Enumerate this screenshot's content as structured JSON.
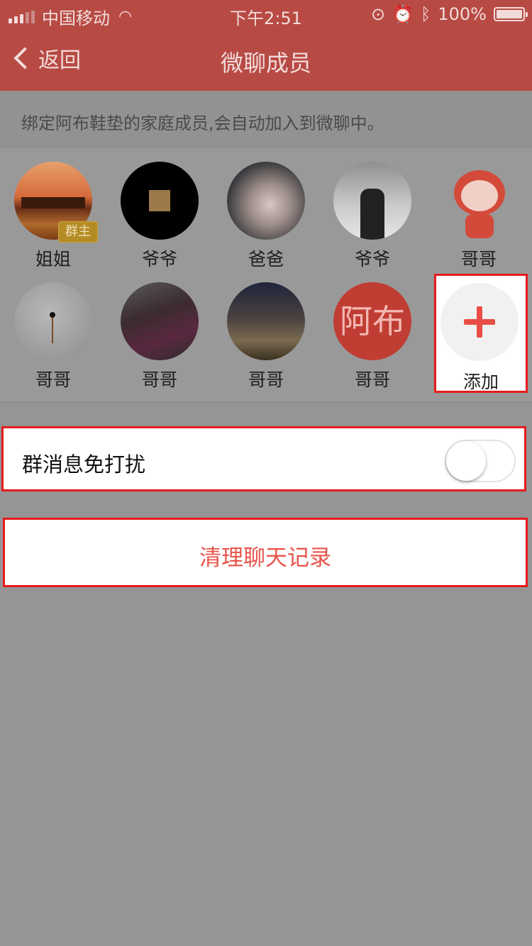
{
  "status_bar": {
    "carrier": "中国移动",
    "time": "下午2:51",
    "battery": "100%"
  },
  "nav": {
    "back_label": "返回",
    "title": "微聊成员"
  },
  "description": "绑定阿布鞋垫的家庭成员,会自动加入到微聊中。",
  "members": [
    {
      "name": "姐姐",
      "badge": "群主"
    },
    {
      "name": "爷爷"
    },
    {
      "name": "爸爸"
    },
    {
      "name": "爷爷"
    },
    {
      "name": "哥哥"
    },
    {
      "name": "哥哥"
    },
    {
      "name": "哥哥"
    },
    {
      "name": "哥哥"
    },
    {
      "name": "哥哥",
      "avatar_text": "阿布"
    }
  ],
  "add": {
    "label": "添加"
  },
  "dnd": {
    "label": "群消息免打扰",
    "enabled": false
  },
  "clear": {
    "label": "清理聊天记录"
  },
  "colors": {
    "header": "#b84a44",
    "accent_red": "#e8544a",
    "highlight_border": "#e51c1c"
  }
}
